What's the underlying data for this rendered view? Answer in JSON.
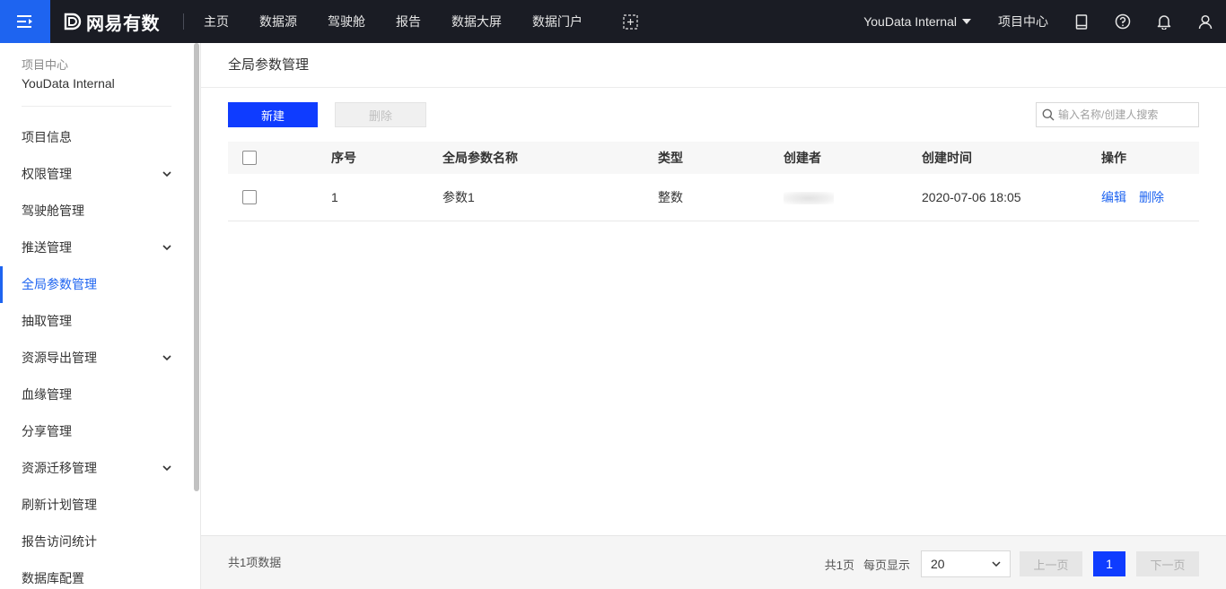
{
  "topbar": {
    "brand": "网易有数",
    "nav": [
      "主页",
      "数据源",
      "驾驶舱",
      "报告",
      "数据大屏",
      "数据门户"
    ],
    "project": "YouData Internal",
    "project_center": "项目中心"
  },
  "sidebar": {
    "header_sub": "项目中心",
    "header_main": "YouData Internal",
    "items": [
      {
        "label": "项目信息",
        "expandable": false,
        "active": false
      },
      {
        "label": "权限管理",
        "expandable": true,
        "active": false
      },
      {
        "label": "驾驶舱管理",
        "expandable": false,
        "active": false
      },
      {
        "label": "推送管理",
        "expandable": true,
        "active": false
      },
      {
        "label": "全局参数管理",
        "expandable": false,
        "active": true
      },
      {
        "label": "抽取管理",
        "expandable": false,
        "active": false
      },
      {
        "label": "资源导出管理",
        "expandable": true,
        "active": false
      },
      {
        "label": "血缘管理",
        "expandable": false,
        "active": false
      },
      {
        "label": "分享管理",
        "expandable": false,
        "active": false
      },
      {
        "label": "资源迁移管理",
        "expandable": true,
        "active": false
      },
      {
        "label": "刷新计划管理",
        "expandable": false,
        "active": false
      },
      {
        "label": "报告访问统计",
        "expandable": false,
        "active": false
      },
      {
        "label": "数据库配置",
        "expandable": false,
        "active": false
      }
    ]
  },
  "main": {
    "title": "全局参数管理",
    "new_button": "新建",
    "delete_button": "删除",
    "search_placeholder": "输入名称/创建人搜索",
    "table": {
      "headers": {
        "seq": "序号",
        "name": "全局参数名称",
        "type": "类型",
        "creator": "创建者",
        "created_at": "创建时间",
        "ops": "操作"
      },
      "rows": [
        {
          "seq": "1",
          "name": "参数1",
          "type": "整数",
          "creator": "",
          "created_at": "2020-07-06 18:05",
          "edit": "编辑",
          "delete": "删除"
        }
      ]
    }
  },
  "footer": {
    "total": "共1项数据",
    "pages": "共1页",
    "per_page_label": "每页显示",
    "per_page": "20",
    "prev": "上一页",
    "current_page": "1",
    "next": "下一页"
  },
  "colors": {
    "accent": "#1e64f0",
    "primary_button": "#0f3cff",
    "topbar_bg": "#1a1c24"
  }
}
